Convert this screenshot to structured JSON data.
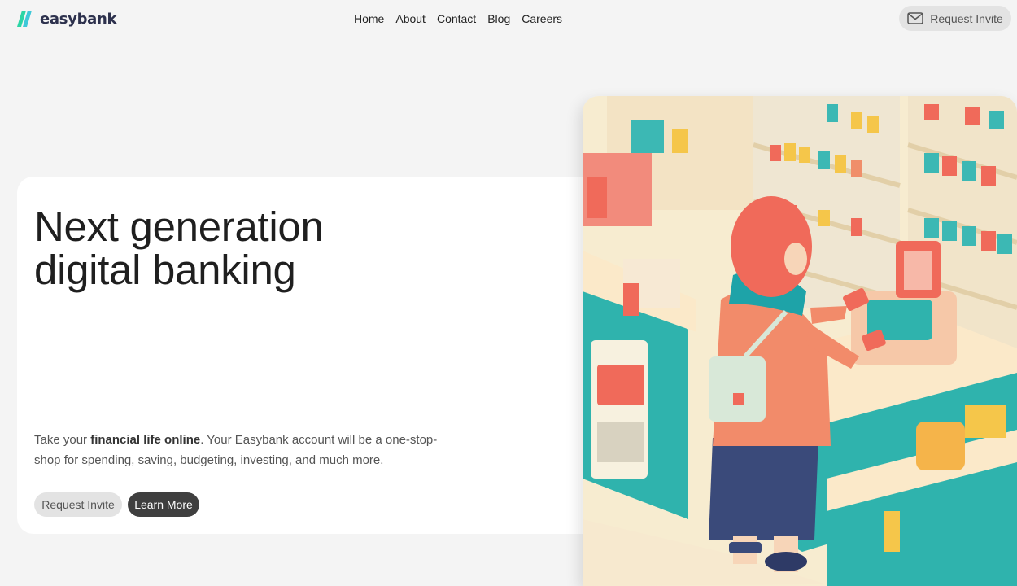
{
  "brand": {
    "name": "easybank",
    "accent": "#2bd5a5"
  },
  "nav": {
    "items": [
      {
        "label": "Home"
      },
      {
        "label": "About"
      },
      {
        "label": "Contact"
      },
      {
        "label": "Blog"
      },
      {
        "label": "Careers"
      }
    ]
  },
  "header": {
    "invite_label": "Request Invite",
    "invite_icon": "mail-icon"
  },
  "hero": {
    "title_line1": "Next generation",
    "title_line2": "digital banking",
    "desc_prefix": "Take your ",
    "desc_bold": "financial life online",
    "desc_suffix": ". Your Easybank account will be a one-stop-shop for spending, saving, budgeting, investing, and much more.",
    "btn_invite": "Request Invite",
    "btn_learn": "Learn More"
  },
  "illustration": {
    "subject": "girl-paying-at-store-checkout-illustration"
  }
}
